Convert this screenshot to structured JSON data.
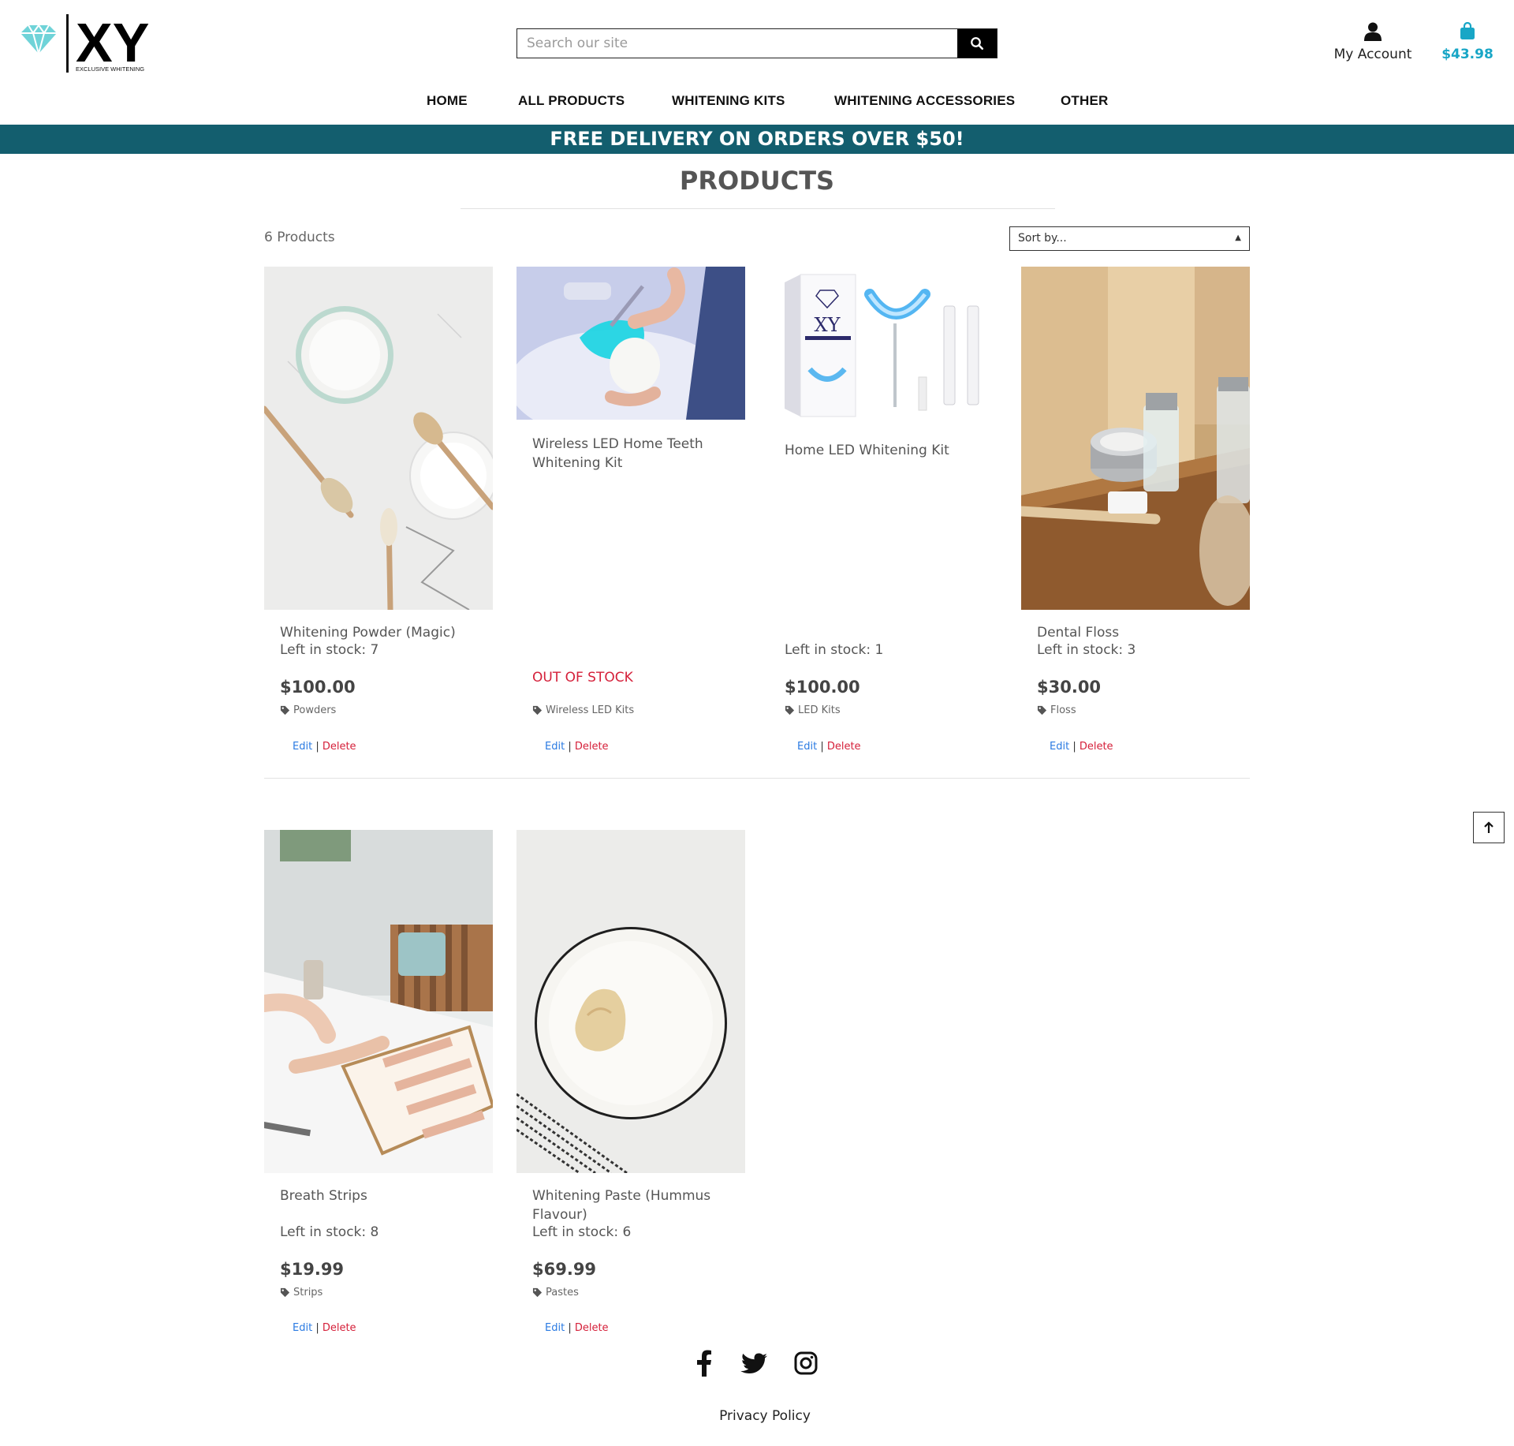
{
  "brand": {
    "name": "XY",
    "tagline": "EXCLUSIVE WHITENING",
    "logo_color": "#6fd3d8"
  },
  "search": {
    "placeholder": "Search our site",
    "icon": "search-icon"
  },
  "account": {
    "label": "My Account",
    "icon": "user-icon"
  },
  "cart": {
    "total": "$43.98",
    "icon": "shopping-bag-icon",
    "color": "#18a6c6"
  },
  "nav": {
    "items": [
      {
        "label": "HOME"
      },
      {
        "label": "ALL PRODUCTS"
      },
      {
        "label": "WHITENING KITS"
      },
      {
        "label": "WHITENING ACCESSORIES"
      },
      {
        "label": "OTHER"
      }
    ]
  },
  "banner": {
    "text": "FREE DELIVERY ON ORDERS OVER $50!",
    "color": "#135e6e"
  },
  "page": {
    "title": "PRODUCTS",
    "count": "6 Products",
    "sort_label": "Sort by..."
  },
  "products": [
    {
      "name": "Whitening Powder (Magic)",
      "stock": "Left in stock: 7",
      "price": "$100.00",
      "category": "Powders",
      "edit": "Edit",
      "delete": "Delete"
    },
    {
      "name": "Wireless LED Home Teeth Whitening Kit",
      "status": "OUT OF STOCK",
      "category": "Wireless LED Kits",
      "edit": "Edit",
      "delete": "Delete"
    },
    {
      "name": "Home LED Whitening Kit",
      "stock": "Left in stock: 1",
      "price": "$100.00",
      "category": "LED Kits",
      "edit": "Edit",
      "delete": "Delete"
    },
    {
      "name": "Dental Floss",
      "stock": "Left in stock: 3",
      "price": "$30.00",
      "category": "Floss",
      "edit": "Edit",
      "delete": "Delete"
    },
    {
      "name": "Breath Strips",
      "stock": "Left in stock: 8",
      "price": "$19.99",
      "category": "Strips",
      "edit": "Edit",
      "delete": "Delete"
    },
    {
      "name": "Whitening Paste (Hummus Flavour)",
      "stock": "Left in stock: 6",
      "price": "$69.99",
      "category": "Pastes",
      "edit": "Edit",
      "delete": "Delete"
    }
  ],
  "product_kit_box": {
    "brand": "XY"
  },
  "footer": {
    "social": [
      "facebook-icon",
      "twitter-icon",
      "instagram-icon"
    ],
    "privacy": "Privacy Policy"
  },
  "back_to_top_icon": "arrow-up-icon"
}
